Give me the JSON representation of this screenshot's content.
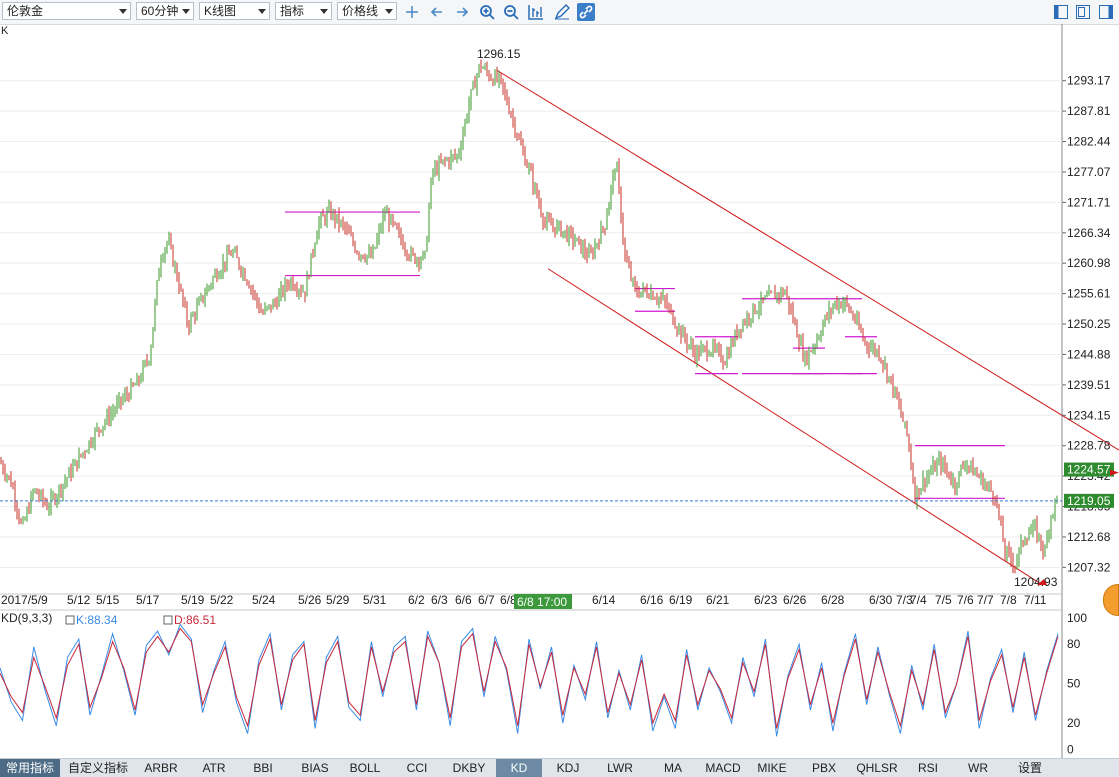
{
  "toolbar": {
    "symbol": "伦敦金",
    "period": "60分钟",
    "chart_kind": "K线图",
    "indicator": "指标",
    "price_line": "价格线"
  },
  "corner_label": "K",
  "bottom_tabs": [
    "常用指标",
    "自定义指标",
    "ARBR",
    "ATR",
    "BBI",
    "BIAS",
    "BOLL",
    "CCI",
    "DKBY",
    "KD",
    "KDJ",
    "LWR",
    "MA",
    "MACD",
    "MIKE",
    "PBX",
    "QHLSR",
    "RSI",
    "WR",
    "设置"
  ],
  "active_tab": "KD",
  "colors": {
    "up": "#3a9a2a",
    "down": "#c8322a",
    "channel": "#d01818",
    "box": "#d01ad0",
    "k_line": "#3a8be6",
    "d_line": "#c8283a",
    "current_price": "#3a7ad6",
    "price_tag": "#2e8b2e"
  },
  "chart_data": [
    {
      "type": "candlestick",
      "title": "",
      "y_ticks": [
        1293.17,
        1287.81,
        1282.44,
        1277.07,
        1271.71,
        1266.34,
        1260.98,
        1255.61,
        1250.25,
        1244.88,
        1239.51,
        1234.15,
        1228.78,
        1223.42,
        1218.05,
        1212.68,
        1207.32
      ],
      "ylim": [
        1203.5,
        1300.0
      ],
      "x_ticks": [
        "2017/5/9",
        "5/12",
        "5/15",
        "5/17",
        "5/19",
        "5/22",
        "5/24",
        "5/26",
        "5/29",
        "5/31",
        "6/2",
        "6/3",
        "6/6",
        "6/7",
        "6/8",
        "6/14",
        "6/16",
        "6/19",
        "6/21",
        "6/23",
        "6/26",
        "6/28",
        "6/30",
        "7/3",
        "7/4",
        "7/5",
        "7/6",
        "7/7",
        "7/8",
        "7/11"
      ],
      "crosshair_label": "6/8 17:00",
      "max_label": "1296.15",
      "min_label": "1204.93",
      "last_price": "1219.05",
      "channel_price": "1224.57",
      "path_points": [
        [
          0,
          1226
        ],
        [
          12,
          1222
        ],
        [
          22,
          1214
        ],
        [
          34,
          1221
        ],
        [
          48,
          1218
        ],
        [
          70,
          1224
        ],
        [
          95,
          1231
        ],
        [
          118,
          1236
        ],
        [
          138,
          1240
        ],
        [
          150,
          1245
        ],
        [
          160,
          1262
        ],
        [
          168,
          1265
        ],
        [
          178,
          1258
        ],
        [
          188,
          1250
        ],
        [
          200,
          1254
        ],
        [
          215,
          1259
        ],
        [
          232,
          1263
        ],
        [
          248,
          1258
        ],
        [
          262,
          1252
        ],
        [
          275,
          1254
        ],
        [
          290,
          1258
        ],
        [
          305,
          1256
        ],
        [
          318,
          1268
        ],
        [
          330,
          1270
        ],
        [
          345,
          1267
        ],
        [
          358,
          1263
        ],
        [
          372,
          1262
        ],
        [
          385,
          1270
        ],
        [
          398,
          1266
        ],
        [
          412,
          1262
        ],
        [
          425,
          1262
        ],
        [
          432,
          1277
        ],
        [
          445,
          1279
        ],
        [
          458,
          1280
        ],
        [
          470,
          1290
        ],
        [
          480,
          1296
        ],
        [
          490,
          1294
        ],
        [
          500,
          1293
        ],
        [
          510,
          1288
        ],
        [
          520,
          1282
        ],
        [
          530,
          1277
        ],
        [
          545,
          1268
        ],
        [
          560,
          1267
        ],
        [
          575,
          1265
        ],
        [
          590,
          1262
        ],
        [
          605,
          1268
        ],
        [
          616,
          1279
        ],
        [
          625,
          1262
        ],
        [
          635,
          1256
        ],
        [
          650,
          1256
        ],
        [
          665,
          1254
        ],
        [
          680,
          1249
        ],
        [
          695,
          1245
        ],
        [
          710,
          1246
        ],
        [
          725,
          1244
        ],
        [
          740,
          1250
        ],
        [
          755,
          1253
        ],
        [
          770,
          1255
        ],
        [
          785,
          1256
        ],
        [
          795,
          1250
        ],
        [
          805,
          1244
        ],
        [
          815,
          1247
        ],
        [
          825,
          1251
        ],
        [
          835,
          1254
        ],
        [
          845,
          1254
        ],
        [
          855,
          1251
        ],
        [
          865,
          1247
        ],
        [
          880,
          1245
        ],
        [
          895,
          1238
        ],
        [
          908,
          1230
        ],
        [
          915,
          1220
        ],
        [
          925,
          1223
        ],
        [
          940,
          1226
        ],
        [
          955,
          1222
        ],
        [
          965,
          1226
        ],
        [
          980,
          1223
        ],
        [
          995,
          1220
        ],
        [
          1005,
          1210
        ],
        [
          1015,
          1208
        ],
        [
          1025,
          1213
        ],
        [
          1035,
          1214
        ],
        [
          1045,
          1210
        ],
        [
          1050,
          1216
        ],
        [
          1058,
          1220
        ]
      ],
      "channel": [
        [
          [
            497,
            1295
          ],
          [
            1119,
            1228
          ]
        ],
        [
          [
            548,
            1260
          ],
          [
            1040,
            1204.5
          ]
        ]
      ],
      "boxes": [
        [
          [
            285,
            420
          ],
          [
            1258.8,
            1270
          ]
        ],
        [
          [
            635,
            675
          ],
          [
            1252.5,
            1256.5
          ]
        ],
        [
          [
            695,
            738
          ],
          [
            1241.5,
            1248
          ]
        ],
        [
          [
            742,
            862
          ],
          [
            1241.5,
            1254.7
          ]
        ],
        [
          [
            793,
            825
          ],
          [
            1241.5,
            1246
          ]
        ],
        [
          [
            845,
            877
          ],
          [
            1241.5,
            1248
          ]
        ],
        [
          [
            915,
            1005
          ],
          [
            1219.5,
            1228.8
          ]
        ]
      ]
    },
    {
      "type": "line",
      "title": "KD(9,3,3)",
      "y_ticks": [
        100,
        80,
        50,
        20,
        0
      ],
      "ylim": [
        -5,
        103
      ],
      "series": [
        {
          "name": "K",
          "label": "K:88.34",
          "values": [
            62,
            36,
            22,
            78,
            45,
            18,
            70,
            84,
            26,
            56,
            88,
            60,
            26,
            79,
            90,
            72,
            95,
            84,
            28,
            60,
            82,
            36,
            12,
            68,
            88,
            30,
            72,
            82,
            16,
            70,
            86,
            32,
            22,
            82,
            40,
            78,
            86,
            30,
            90,
            66,
            18,
            82,
            92,
            40,
            86,
            60,
            12,
            84,
            46,
            78,
            20,
            64,
            38,
            82,
            24,
            60,
            30,
            72,
            14,
            40,
            16,
            76,
            30,
            62,
            44,
            20,
            70,
            40,
            84,
            10,
            56,
            80,
            30,
            66,
            14,
            58,
            88,
            34,
            78,
            42,
            12,
            64,
            30,
            80,
            24,
            50,
            90,
            16,
            54,
            76,
            28,
            74,
            22,
            60,
            88
          ]
        },
        {
          "name": "D",
          "label": "D:86.51",
          "values": [
            58,
            40,
            28,
            70,
            48,
            24,
            64,
            80,
            32,
            54,
            82,
            62,
            30,
            74,
            86,
            74,
            92,
            82,
            34,
            58,
            78,
            40,
            18,
            64,
            84,
            34,
            68,
            80,
            22,
            66,
            82,
            36,
            26,
            78,
            44,
            74,
            82,
            34,
            86,
            66,
            24,
            78,
            88,
            44,
            82,
            62,
            18,
            80,
            48,
            74,
            26,
            62,
            42,
            78,
            28,
            58,
            34,
            68,
            20,
            42,
            22,
            72,
            34,
            60,
            46,
            24,
            66,
            44,
            80,
            16,
            54,
            76,
            34,
            62,
            20,
            56,
            84,
            38,
            74,
            44,
            18,
            60,
            34,
            76,
            28,
            50,
            86,
            22,
            52,
            72,
            32,
            70,
            26,
            58,
            86
          ]
        }
      ]
    }
  ]
}
